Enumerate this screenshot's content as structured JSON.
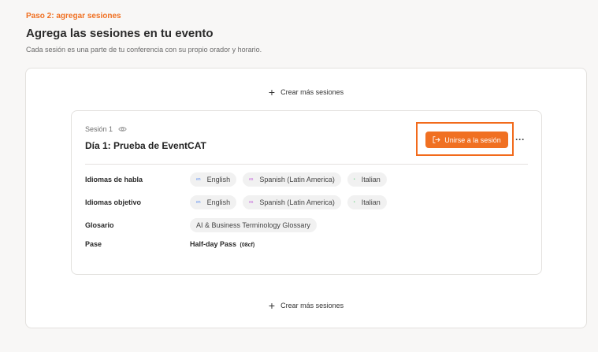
{
  "header": {
    "step": "Paso 2: agregar sesiones",
    "title": "Agrega las sesiones en tu evento",
    "subtitle": "Cada sesión es una parte de tu conferencia con su propio orador y horario."
  },
  "add_sessions_label": "Crear más sesiones",
  "session": {
    "label": "Sesión 1",
    "title": "Día 1: Prueba de EventCAT",
    "join_label": "Unirse a la sesión",
    "more_label": "···",
    "rows": {
      "spoken": {
        "label": "Idiomas de habla",
        "chips": [
          {
            "text": "English",
            "dot": "en"
          },
          {
            "text": "Spanish (Latin America)",
            "dot": "es"
          },
          {
            "text": "Italian",
            "dot": "•"
          }
        ]
      },
      "target": {
        "label": "Idiomas objetivo",
        "chips": [
          {
            "text": "English",
            "dot": "en"
          },
          {
            "text": "Spanish (Latin America)",
            "dot": "es"
          },
          {
            "text": "Italian",
            "dot": "•"
          }
        ]
      },
      "glossary": {
        "label": "Glosario",
        "value": "AI & Business Terminology Glossary"
      },
      "pass": {
        "label": "Pase",
        "value": "Half-day Pass",
        "code": "(08cf)"
      }
    }
  },
  "colors": {
    "accent": "#f07022",
    "highlight_frame": "#f26a1b",
    "background": "#f8f7f6"
  }
}
